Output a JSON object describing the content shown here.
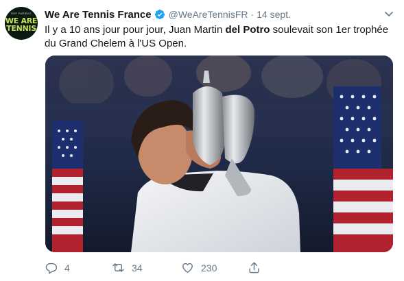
{
  "account": {
    "display_name": "We Are Tennis France",
    "handle": "@WeAreTennisFR",
    "separator": "·",
    "date": "14 sept.",
    "avatar": {
      "brand": "BNP PARIBAS",
      "logo_line_1": "WE ARE",
      "logo_line_2": "TENNIS"
    }
  },
  "tweet": {
    "text_before": "Il y a 10 ans jour pour jour, Juan Martin ",
    "text_bold": "del Potro",
    "text_after": " soulevait son 1er trophée du Grand Chelem à l'US Open."
  },
  "actions": {
    "replies": "4",
    "retweets": "34",
    "likes": "230"
  },
  "colors": {
    "text": "#14171a",
    "secondary": "#657786",
    "verified": "#1da1f2"
  },
  "icons": [
    "verified-badge-icon",
    "chevron-down-icon",
    "reply-icon",
    "retweet-icon",
    "like-icon",
    "share-icon"
  ]
}
